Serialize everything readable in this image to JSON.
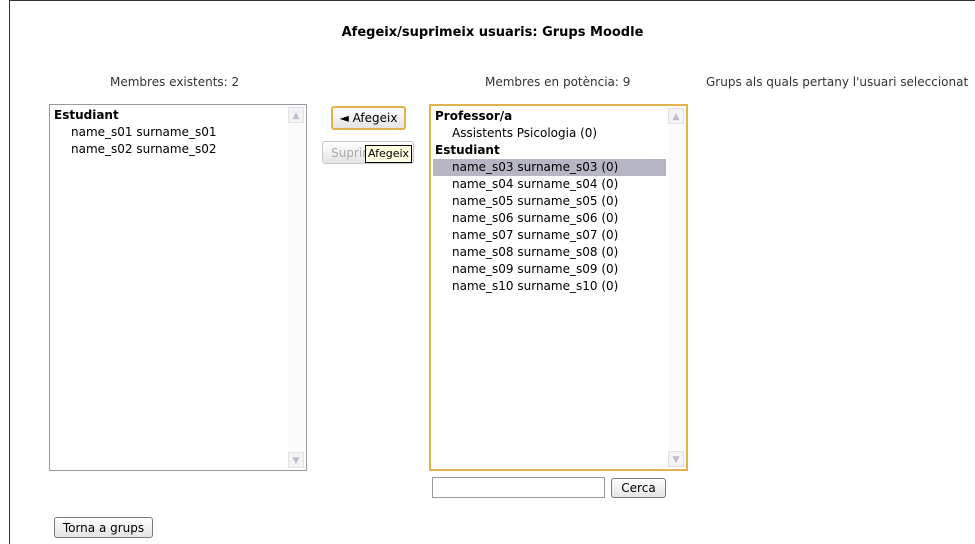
{
  "title": "Afegeix/suprimeix usuaris: Grups Moodle",
  "existing": {
    "label": "Membres existents: 2",
    "groups": [
      {
        "name": "Estudiant",
        "items": [
          "name_s01 surname_s01",
          "name_s02 surname_s02"
        ]
      }
    ]
  },
  "potential": {
    "label": "Membres en potència: 9",
    "groups": [
      {
        "name": "Professor/a",
        "items": [
          "Assistents Psicologia (0)"
        ]
      },
      {
        "name": "Estudiant",
        "items": [
          "name_s03 surname_s03 (0)",
          "name_s04 surname_s04 (0)",
          "name_s05 surname_s05 (0)",
          "name_s06 surname_s06 (0)",
          "name_s07 surname_s07 (0)",
          "name_s08 surname_s08 (0)",
          "name_s09 surname_s09 (0)",
          "name_s10 surname_s10 (0)"
        ]
      }
    ],
    "selected": "name_s03 surname_s03 (0)"
  },
  "groups_label": "Grups als quals pertany l'usuari seleccionat",
  "buttons": {
    "add": "◄ Afegeix",
    "remove": "Suprimeix ►",
    "search": "Cerca",
    "back": "Torna a grups"
  },
  "tooltip": "Afegeix",
  "search_value": ""
}
